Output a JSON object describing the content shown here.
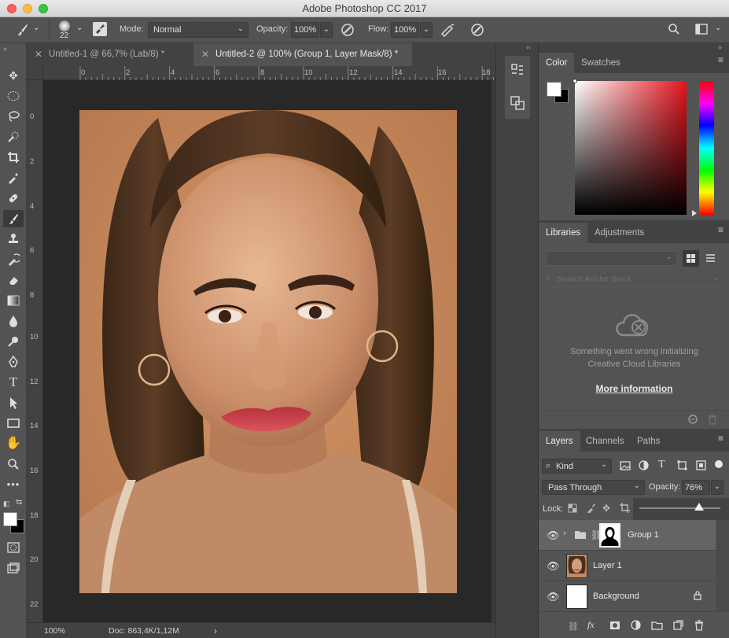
{
  "window": {
    "title": "Adobe Photoshop CC 2017"
  },
  "options": {
    "brush_size": "22",
    "mode_label": "Mode:",
    "mode_value": "Normal",
    "opacity_label": "Opacity:",
    "opacity_value": "100%",
    "flow_label": "Flow:",
    "flow_value": "100%"
  },
  "tabs": [
    {
      "label": "Untitled-1 @ 66,7% (Lab/8) *",
      "active": false
    },
    {
      "label": "Untitled-2 @ 100% (Group 1, Layer Mask/8) *",
      "active": true
    }
  ],
  "rulers": {
    "h_ticks": [
      "0",
      "2",
      "4",
      "6",
      "8",
      "10",
      "12",
      "14",
      "16",
      "18"
    ],
    "v_ticks": [
      "0",
      "2",
      "4",
      "6",
      "8",
      "10",
      "12",
      "14",
      "16",
      "18",
      "20",
      "22"
    ]
  },
  "status": {
    "zoom": "100%",
    "doc_info": "Doc: 863,4K/1,12M",
    "arrow": "›"
  },
  "color_panel": {
    "tabs": [
      "Color",
      "Swatches"
    ],
    "fg": "#ffffff",
    "bg": "#000000",
    "hue_accent": "#e6121b"
  },
  "libraries_panel": {
    "tabs": [
      "Libraries",
      "Adjustments"
    ],
    "search_placeholder": "Search Adobe Stock",
    "error_line1": "Something went wrong initializing",
    "error_line2": "Creative Cloud Libraries",
    "more_info": "More information"
  },
  "layers_panel": {
    "tabs": [
      "Layers",
      "Channels",
      "Paths"
    ],
    "filter_kind": "Kind",
    "blend_mode": "Pass Through",
    "opacity_label": "Opacity:",
    "opacity_value": "76%",
    "lock_label": "Lock:",
    "layers": [
      {
        "name": "Group 1",
        "type": "group",
        "selected": true
      },
      {
        "name": "Layer 1",
        "type": "photo",
        "selected": false
      },
      {
        "name": "Background",
        "type": "background",
        "selected": false,
        "locked": true
      }
    ]
  }
}
